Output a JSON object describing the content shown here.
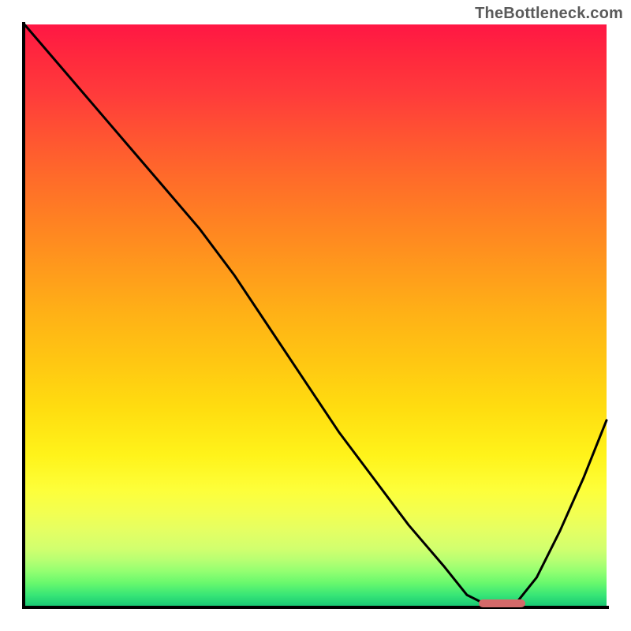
{
  "watermark": "TheBottleneck.com",
  "chart_data": {
    "type": "line",
    "title": "",
    "xlabel": "",
    "ylabel": "",
    "xlim": [
      0,
      100
    ],
    "ylim": [
      0,
      100
    ],
    "grid": false,
    "legend": false,
    "annotations": [],
    "background_gradient_top_color": "#ff1744",
    "background_gradient_bottom_color": "#17c774",
    "series": [
      {
        "name": "bottleneck-curve",
        "color": "#000000",
        "x": [
          0,
          6,
          12,
          18,
          24,
          30,
          36,
          42,
          48,
          54,
          60,
          66,
          72,
          76,
          80,
          84,
          88,
          92,
          96,
          100
        ],
        "y": [
          100,
          93,
          86,
          79,
          72,
          65,
          57,
          48,
          39,
          30,
          22,
          14,
          7,
          2,
          0,
          0,
          5,
          13,
          22,
          32
        ]
      }
    ],
    "marker": {
      "name": "optimal-zone",
      "color": "#d46a6a",
      "x_start": 78,
      "x_end": 86,
      "y": 0.5
    }
  }
}
